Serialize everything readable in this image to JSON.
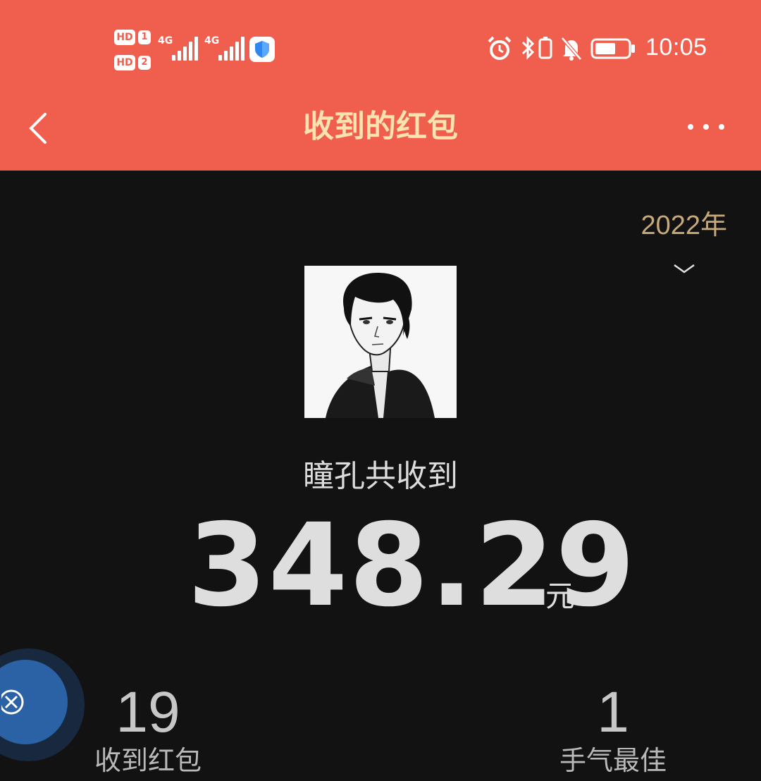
{
  "status_bar": {
    "sim1_label": "HD",
    "sim1_index": "1",
    "sim2_label": "HD",
    "sim2_index": "2",
    "network1": "4G",
    "network2": "4G",
    "time": "10:05",
    "icons": [
      "alarm-icon",
      "bluetooth-icon",
      "vibrate-icon",
      "mute-bell-icon",
      "battery-icon",
      "security-shield-icon"
    ]
  },
  "header": {
    "title": "收到的红包",
    "back_icon": "chevron-left-icon",
    "more_icon": "more-dots-icon",
    "background": "#F05F4E",
    "title_color": "#FBE3B0"
  },
  "filter": {
    "year": "2022年"
  },
  "summary": {
    "owner_line": "瞳孔共收到",
    "amount": "348.29",
    "unit": "元"
  },
  "stats": {
    "received_count": "19",
    "received_label": "收到红包",
    "best_luck_count": "1",
    "best_luck_label": "手气最佳"
  },
  "colors": {
    "page_bg": "#121212",
    "accent_gold": "#C8A97A",
    "floating_button": "#2B62A6"
  }
}
